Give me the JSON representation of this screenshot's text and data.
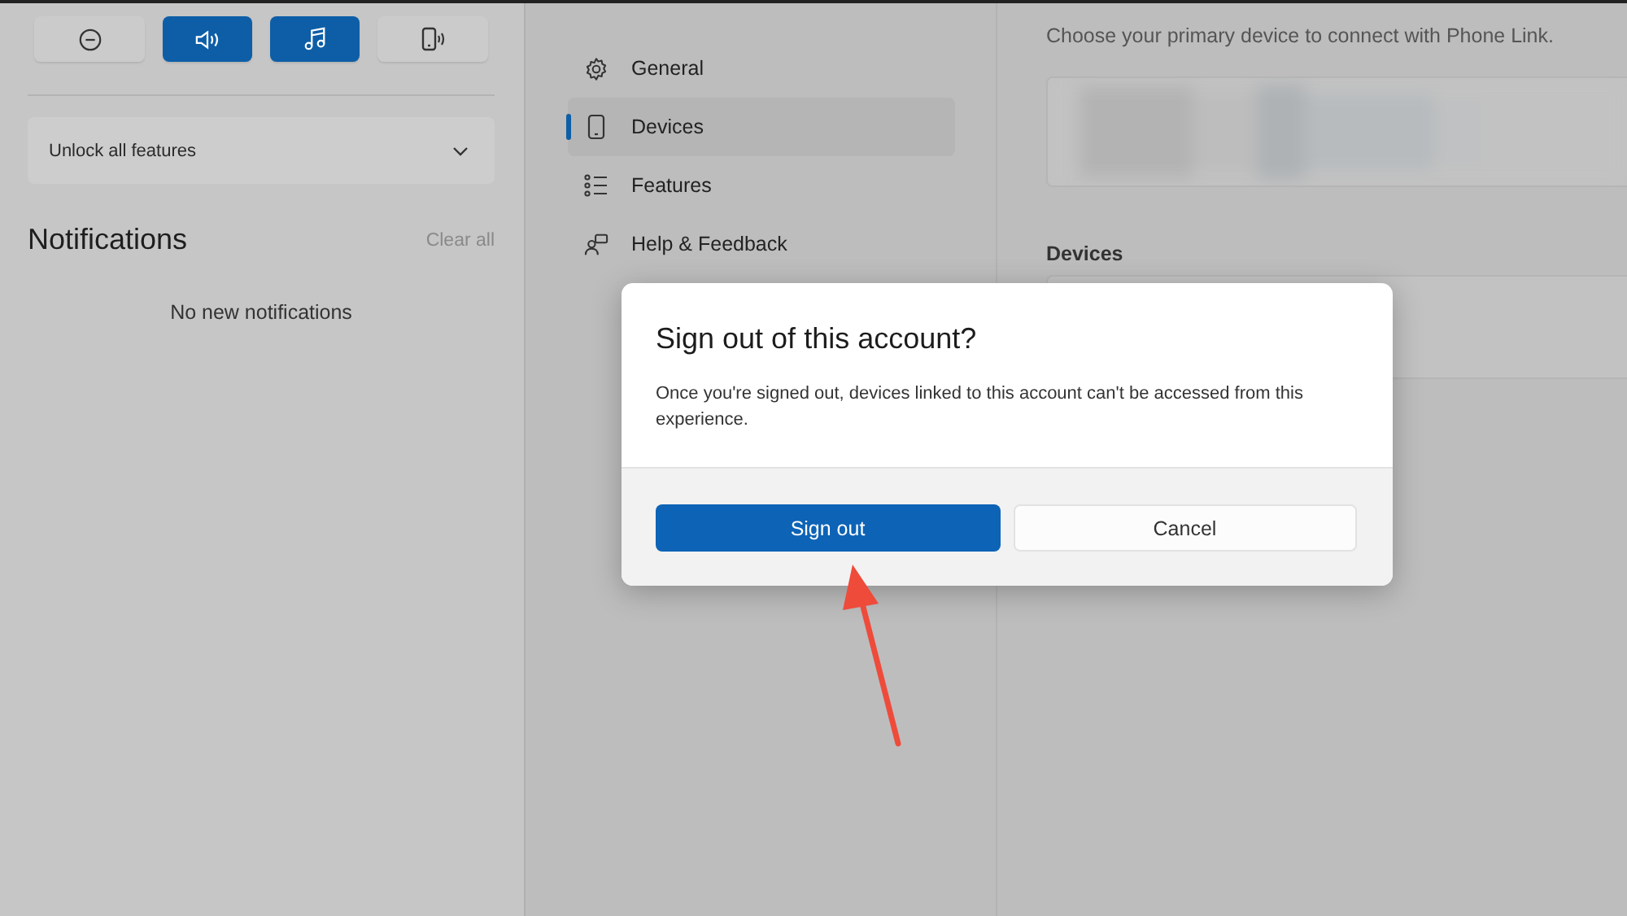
{
  "quick_actions": [
    {
      "kind": "minus",
      "selected": false
    },
    {
      "kind": "speaker",
      "selected": true
    },
    {
      "kind": "music",
      "selected": true
    },
    {
      "kind": "phone",
      "selected": false
    }
  ],
  "unlock_dropdown": {
    "label": "Unlock all features",
    "expanded": false
  },
  "notifications": {
    "title": "Notifications",
    "clear_label": "Clear all",
    "empty_text": "No new notifications"
  },
  "settings": {
    "nav": [
      {
        "kind": "gear",
        "label": "General",
        "selected": false
      },
      {
        "kind": "phone",
        "label": "Devices",
        "selected": true
      },
      {
        "kind": "list",
        "label": "Features",
        "selected": false
      },
      {
        "kind": "help",
        "label": "Help & Feedback",
        "selected": false
      }
    ]
  },
  "devices_page": {
    "subtitle": "Choose your primary device to connect with Phone Link.",
    "section_label": "Devices"
  },
  "dialog": {
    "title": "Sign out of this account?",
    "body": "Once you're signed out, devices linked to this account can't be accessed from this experience.",
    "primary_button": "Sign out",
    "secondary_button": "Cancel"
  }
}
